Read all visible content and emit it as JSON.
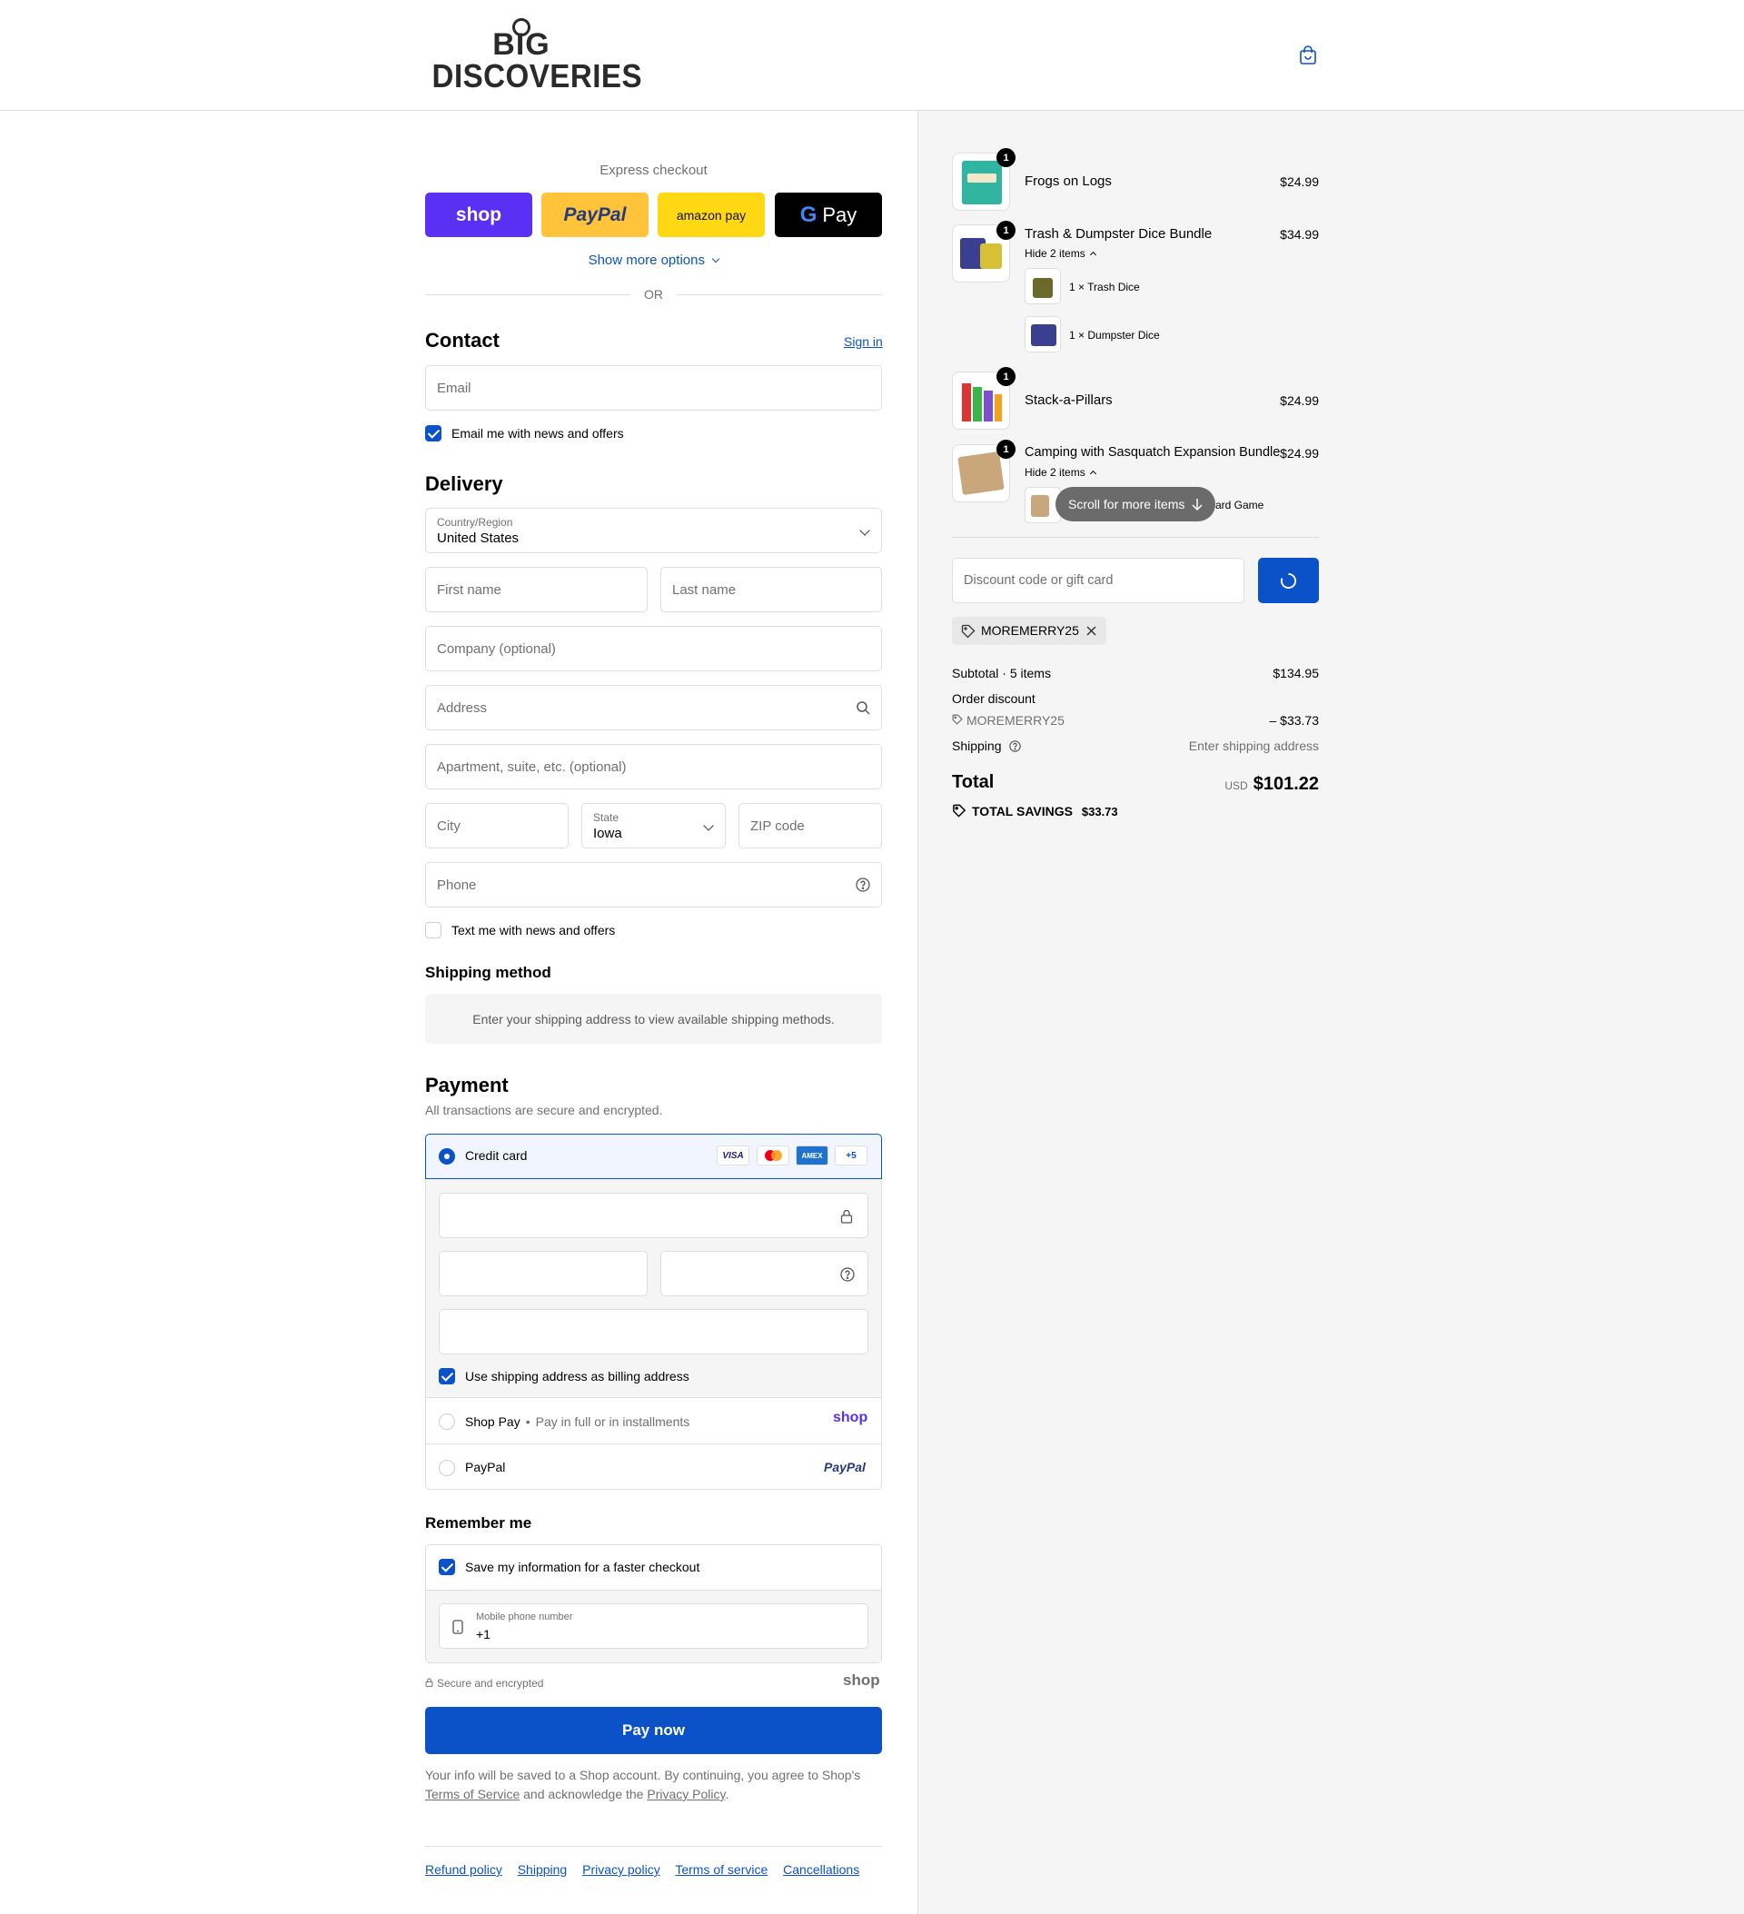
{
  "header": {
    "logo_line1": "BIG",
    "logo_line2": "DISCOVERIES"
  },
  "express": {
    "title": "Express checkout",
    "shop": "shop",
    "paypal": "PayPal",
    "amazon": "amazon pay",
    "gpay": "Pay",
    "show_more": "Show more options",
    "or": "OR"
  },
  "contact": {
    "title": "Contact",
    "sign_in": "Sign in",
    "email_placeholder": "Email",
    "email_opt": "Email me with news and offers"
  },
  "delivery": {
    "title": "Delivery",
    "country_label": "Country/Region",
    "country_value": "United States",
    "first_name": "First name",
    "last_name": "Last name",
    "company": "Company (optional)",
    "address": "Address",
    "apartment": "Apartment, suite, etc. (optional)",
    "city": "City",
    "state_label": "State",
    "state_value": "Iowa",
    "zip": "ZIP code",
    "phone": "Phone",
    "text_opt": "Text me with news and offers"
  },
  "shipping_method": {
    "title": "Shipping method",
    "message": "Enter your shipping address to view available shipping methods."
  },
  "payment": {
    "title": "Payment",
    "subtitle": "All transactions are secure and encrypted.",
    "credit_card": "Credit card",
    "badges": {
      "visa": "VISA",
      "amex": "AMEX",
      "more": "+5"
    },
    "billing_same": "Use shipping address as billing address",
    "shop_pay": "Shop Pay",
    "shop_pay_desc": "Pay in full or in installments",
    "shop_logo": "shop",
    "paypal": "PayPal",
    "paypal_logo": "PayPal"
  },
  "remember": {
    "title": "Remember me",
    "save_info": "Save my information for a faster checkout",
    "mobile_label": "Mobile phone number",
    "mobile_value": "+1"
  },
  "secure": {
    "text": "Secure and encrypted",
    "shop_logo": "shop"
  },
  "pay_now": "Pay now",
  "legal": {
    "text1": "Your info will be saved to a Shop account. By continuing, you agree to Shop's",
    "tos": "Terms of Service",
    "text2": "and acknowledge the",
    "privacy": "Privacy Policy",
    "period": "."
  },
  "footer_links": [
    "Refund policy",
    "Shipping",
    "Privacy policy",
    "Terms of service",
    "Cancellations"
  ],
  "order": {
    "items": [
      {
        "name": "Frogs on Logs",
        "price": "$24.99",
        "qty": "1"
      },
      {
        "name": "Trash & Dumpster Dice Bundle",
        "price": "$34.99",
        "qty": "1",
        "toggle": "Hide 2 items",
        "sub": [
          "1 × Trash Dice",
          "1 × Dumpster Dice"
        ]
      },
      {
        "name": "Stack-a-Pillars",
        "price": "$24.99",
        "qty": "1"
      },
      {
        "name": "Camping with Sasquatch Expansion Bundle",
        "price": "$24.99",
        "qty": "1",
        "toggle": "Hide 2 items",
        "sub_partial": "ard Game"
      }
    ],
    "scroll_hint": "Scroll for more items",
    "discount_placeholder": "Discount code or gift card",
    "applied_code": "MOREMERRY25",
    "subtotal_label": "Subtotal · 5 items",
    "subtotal": "$134.95",
    "order_discount_label": "Order discount",
    "discount_code": "MOREMERRY25",
    "discount_value": "– $33.73",
    "shipping_label": "Shipping",
    "shipping_value": "Enter shipping address",
    "total_label": "Total",
    "currency": "USD",
    "total": "$101.22",
    "savings_label": "TOTAL SAVINGS",
    "savings": "$33.73"
  },
  "colors": {
    "accent": "#0b52c9",
    "shop_purple": "#5a31f4",
    "paypal_yellow": "#ffc439",
    "amazon_yellow": "#ffd814"
  }
}
